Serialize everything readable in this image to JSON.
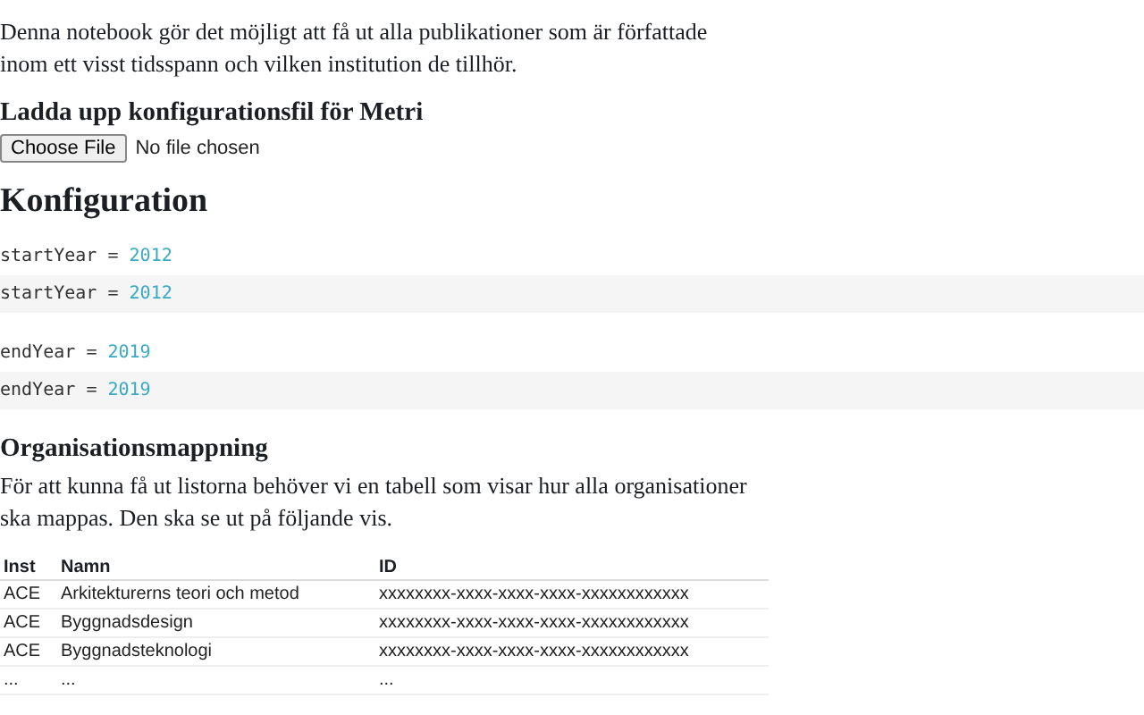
{
  "intro": "Denna notebook gör det möjligt att få ut alla publikationer som är författade inom ett visst tidsspann och vilken institution de tillhör.",
  "upload": {
    "heading": "Ladda upp konfigurationsfil för Metri",
    "button": "Choose File",
    "status": "No file chosen"
  },
  "config": {
    "heading": "Konfiguration",
    "cells": [
      {
        "kind": "output",
        "name": "startYear",
        "op": "=",
        "value": "2012"
      },
      {
        "kind": "source",
        "name": "startYear",
        "op": "=",
        "value": "2012"
      },
      {
        "kind": "output",
        "name": "endYear",
        "op": "=",
        "value": "2019"
      },
      {
        "kind": "source",
        "name": "endYear",
        "op": "=",
        "value": "2019"
      }
    ]
  },
  "mapping": {
    "heading": "Organisationsmappning",
    "text": "För att kunna få ut listorna behöver vi en tabell som visar hur alla organisationer ska mappas. Den ska se ut på följande vis.",
    "table": {
      "columns": [
        "Inst",
        "Namn",
        "ID"
      ],
      "rows": [
        [
          "ACE",
          "Arkitekturerns teori och metod",
          "xxxxxxxx-xxxx-xxxx-xxxx-xxxxxxxxxxxx"
        ],
        [
          "ACE",
          "Byggnadsdesign",
          "xxxxxxxx-xxxx-xxxx-xxxx-xxxxxxxxxxxx"
        ],
        [
          "ACE",
          "Byggnadsteknologi",
          "xxxxxxxx-xxxx-xxxx-xxxx-xxxxxxxxxxxx"
        ],
        [
          "...",
          "...",
          "..."
        ]
      ]
    }
  }
}
